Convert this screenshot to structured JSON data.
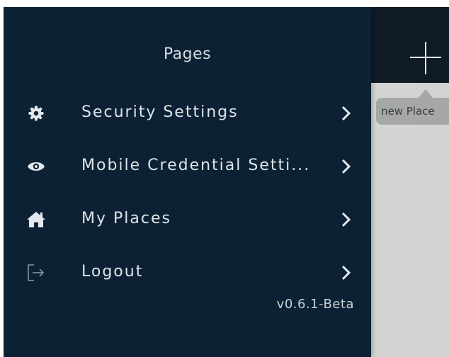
{
  "drawer": {
    "title": "Pages",
    "items": [
      {
        "label": "Security Settings",
        "icon": "gear-icon"
      },
      {
        "label": "Mobile Credential Setti...",
        "icon": "eye-icon"
      },
      {
        "label": "My Places",
        "icon": "home-icon"
      },
      {
        "label": "Logout",
        "icon": "logout-icon"
      }
    ],
    "version": "v0.6.1-Beta"
  },
  "main": {
    "add_button_icon": "plus-icon",
    "tooltip": "new Place"
  },
  "colors": {
    "drawer_bg": "#0c2234",
    "topbar_bg": "#0e1a24",
    "text": "#dfe4e8",
    "tooltip_bg": "#a6a8a8"
  }
}
